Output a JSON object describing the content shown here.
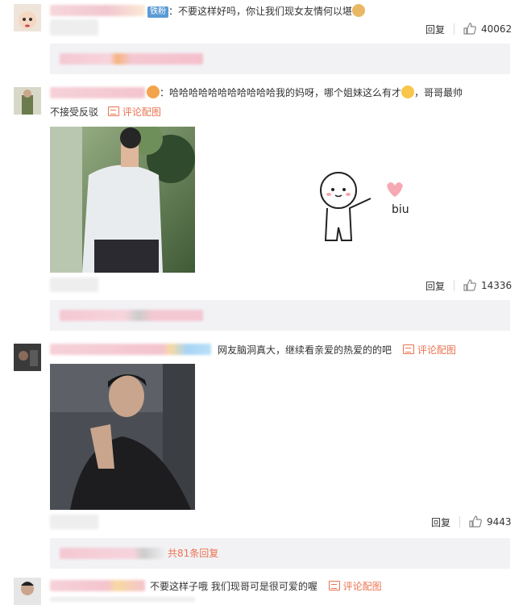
{
  "comments": [
    {
      "badge": "铁粉",
      "text": "：不要这样好吗，你让我们现女友情何以堪",
      "actions": {
        "reply": "回复",
        "likes": "40062"
      }
    },
    {
      "text_line1": "：哈哈哈哈哈哈哈哈哈哈哈我的妈呀，哪个姐妹这么有才",
      "text_tail": "，哥哥最帅",
      "text_line2": "不接受反驳",
      "view_image": "评论配图",
      "sticker_text": "biu",
      "actions": {
        "reply": "回复",
        "likes": "14336"
      }
    },
    {
      "text": "网友脑洞真大，继续看亲爱的热爱的的吧",
      "view_image": "评论配图",
      "actions": {
        "reply": "回复",
        "likes": "9443"
      },
      "replies_total": "共81条回复"
    },
    {
      "text": "不要这样子哦 我们现哥可是很可爱的喔",
      "view_image": "评论配图"
    }
  ],
  "colors": {
    "accent": "#eb7350",
    "reply_bg": "#f2f2f5",
    "badge": "#5b9bd5"
  }
}
